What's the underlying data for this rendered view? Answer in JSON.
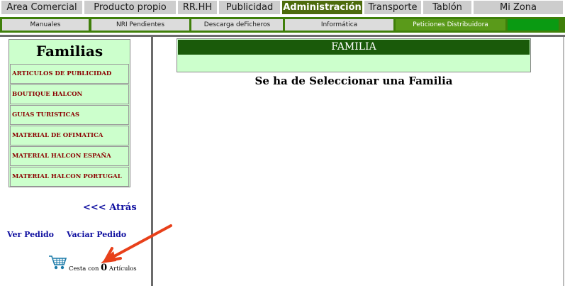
{
  "top_nav": {
    "items": [
      {
        "label": "Area Comercial"
      },
      {
        "label": "Producto propio"
      },
      {
        "label": "RR.HH"
      },
      {
        "label": "Publicidad"
      },
      {
        "label": "Administración"
      },
      {
        "label": "Transporte"
      },
      {
        "label": "Tablón"
      },
      {
        "label": "Mi Zona"
      }
    ],
    "active_index": 4
  },
  "sub_nav": {
    "items": [
      {
        "label": "Manuales"
      },
      {
        "label": "NRI Pendientes"
      },
      {
        "label": "Descarga deFicheros"
      },
      {
        "label": "Informática"
      },
      {
        "label": "Peticiones Distribuidora"
      },
      {
        "label": ""
      }
    ],
    "active_index": 4
  },
  "sidebar": {
    "title": "Familias",
    "items": [
      {
        "label": "ARTICULOS DE PUBLICIDAD"
      },
      {
        "label": "BOUTIQUE HALCON"
      },
      {
        "label": "GUIAS TURISTICAS"
      },
      {
        "label": "MATERIAL DE OFIMATICA"
      },
      {
        "label": "MATERIAL HALCON ESPAÑA"
      },
      {
        "label": "MATERIAL HALCON PORTUGAL"
      }
    ],
    "back_link": "<<< Atrás",
    "ver_pedido": "Ver Pedido",
    "vaciar_pedido": "Vaciar Pedido",
    "cart": {
      "prefix": "Cesta con",
      "count": "0",
      "suffix": "Artículos"
    }
  },
  "main": {
    "panel_header": "FAMILIA",
    "message": "Se ha de Seleccionar una Familia"
  },
  "colors": {
    "active_tab": "#4d6b0c",
    "subnav_bar": "#3f7f0a",
    "family_bg": "#ccffcc",
    "family_text": "#8b0000",
    "link": "#1010a0",
    "panel_header": "#1a5a0a",
    "annotation_arrow": "#e8401a"
  },
  "icons": {
    "cart": "shopping-cart-icon",
    "annotation": "red-arrow-icon"
  }
}
